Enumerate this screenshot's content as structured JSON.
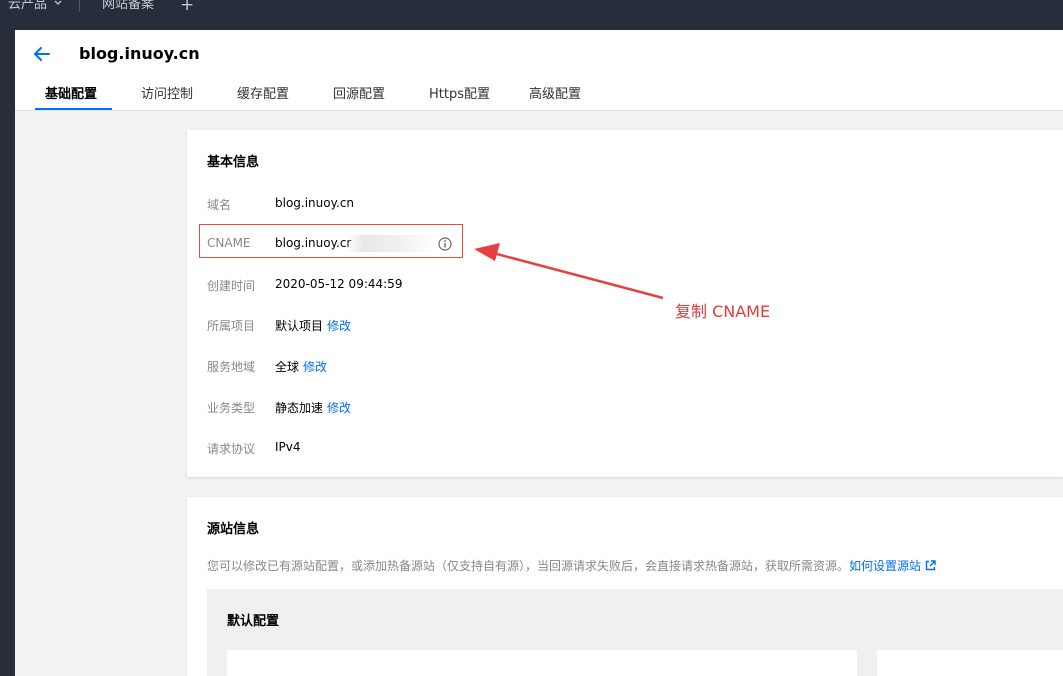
{
  "topbar": {
    "products": "云产品",
    "record": "网站备案",
    "add": "+"
  },
  "header": {
    "title": "blog.inuoy.cn"
  },
  "tabs": [
    "基础配置",
    "访问控制",
    "缓存配置",
    "回源配置",
    "Https配置",
    "高级配置"
  ],
  "basic": {
    "title": "基本信息",
    "rows": [
      {
        "label": "域名",
        "value": "blog.inuoy.cn",
        "link": ""
      },
      {
        "label": "CNAME",
        "value": "blog.inuoy.cr",
        "link": ""
      },
      {
        "label": "创建时间",
        "value": "2020-05-12 09:44:59",
        "link": ""
      },
      {
        "label": "所属项目",
        "value": "默认项目",
        "link": "修改"
      },
      {
        "label": "服务地域",
        "value": "全球",
        "link": "修改"
      },
      {
        "label": "业务类型",
        "value": "静态加速",
        "link": "修改"
      },
      {
        "label": "请求协议",
        "value": "IPv4",
        "link": ""
      }
    ]
  },
  "annotation": "复制 CNAME",
  "origin": {
    "title": "源站信息",
    "desc": "您可以修改已有源站配置，或添加热备源站（仅支持自有源），当回源请求失败后，会直接请求热备源站，获取所需资源。",
    "help_link": "如何设置源站",
    "default_title": "默认配置"
  },
  "colors": {
    "accent": "#006eff",
    "annotation": "#e03c3c",
    "topbar": "#262e3c"
  }
}
